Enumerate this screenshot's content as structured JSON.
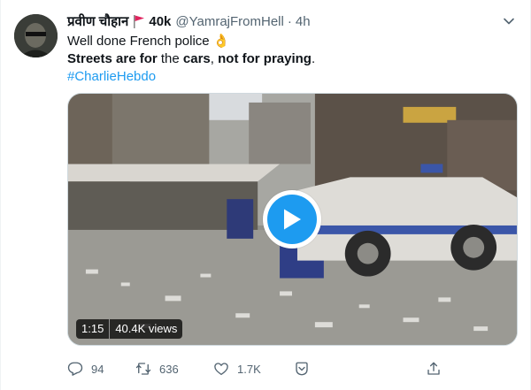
{
  "tweet": {
    "display_name": "प्रवीण चौहान",
    "name_suffix": "40k",
    "handle": "@YamrajFromHell",
    "separator": "·",
    "time": "4h",
    "text_line1": "Well done French police 👌",
    "text_line2_a": "Streets are for",
    "text_line2_b": " the ",
    "text_line2_c": "cars",
    "text_line2_d": ", ",
    "text_line2_e": "not for praying",
    "text_line2_f": ".",
    "hashtag": "#CharlieHebdo"
  },
  "media": {
    "duration": "1:15",
    "views": "40.4K views"
  },
  "actions": {
    "replies": "94",
    "retweets": "636",
    "likes": "1.7K"
  },
  "colors": {
    "accent": "#1d9bf0",
    "muted": "#536471",
    "flag": "#e0245e"
  },
  "icons": [
    "flag-icon",
    "chevron-down-icon",
    "play-icon",
    "reply-icon",
    "retweet-icon",
    "like-icon",
    "bookmark-icon",
    "share-icon"
  ]
}
